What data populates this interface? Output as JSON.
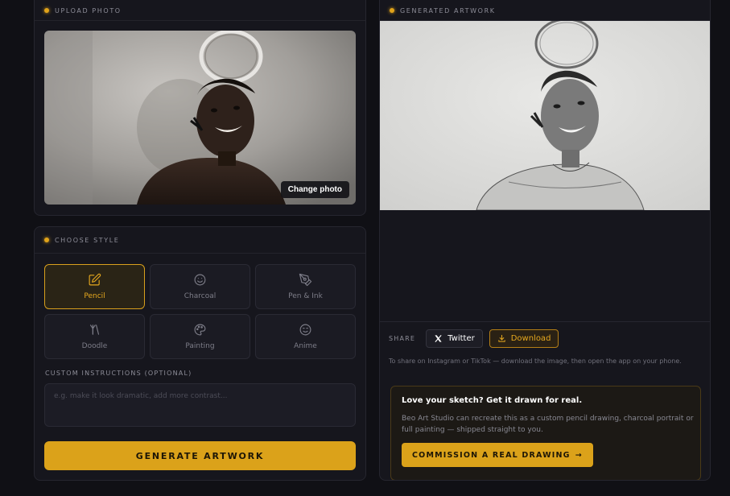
{
  "upload": {
    "header": "UPLOAD PHOTO",
    "change_photo_label": "Change photo"
  },
  "style": {
    "header": "CHOOSE STYLE",
    "options": [
      {
        "label": "Pencil",
        "icon": "pencil-square-icon",
        "selected": true
      },
      {
        "label": "Charcoal",
        "icon": "smiley-icon",
        "selected": false
      },
      {
        "label": "Pen & Ink",
        "icon": "pen-nib-icon",
        "selected": false
      },
      {
        "label": "Doodle",
        "icon": "doodle-icon",
        "selected": false
      },
      {
        "label": "Painting",
        "icon": "palette-icon",
        "selected": false
      },
      {
        "label": "Anime",
        "icon": "anime-face-icon",
        "selected": false
      }
    ],
    "custom_instructions_label": "CUSTOM INSTRUCTIONS (OPTIONAL)",
    "custom_instructions_placeholder": "e.g. make it look dramatic, add more contrast...",
    "custom_instructions_value": "",
    "generate_label": "GENERATE ARTWORK"
  },
  "artwork": {
    "header": "GENERATED ARTWORK",
    "share_label": "SHARE",
    "twitter_label": "Twitter",
    "download_label": "Download",
    "share_note": "To share on Instagram or TikTok — download the image, then open the app on your phone.",
    "promo_title": "Love your sketch? Get it drawn for real.",
    "promo_body": "Beo Art Studio can recreate this as a custom pencil drawing, charcoal portrait or full painting — shipped straight to you.",
    "commission_label": "COMMISSION A REAL DRAWING",
    "commission_arrow": "→"
  },
  "colors": {
    "accent": "#dba21a",
    "background": "#101015",
    "card": "#16161d"
  }
}
